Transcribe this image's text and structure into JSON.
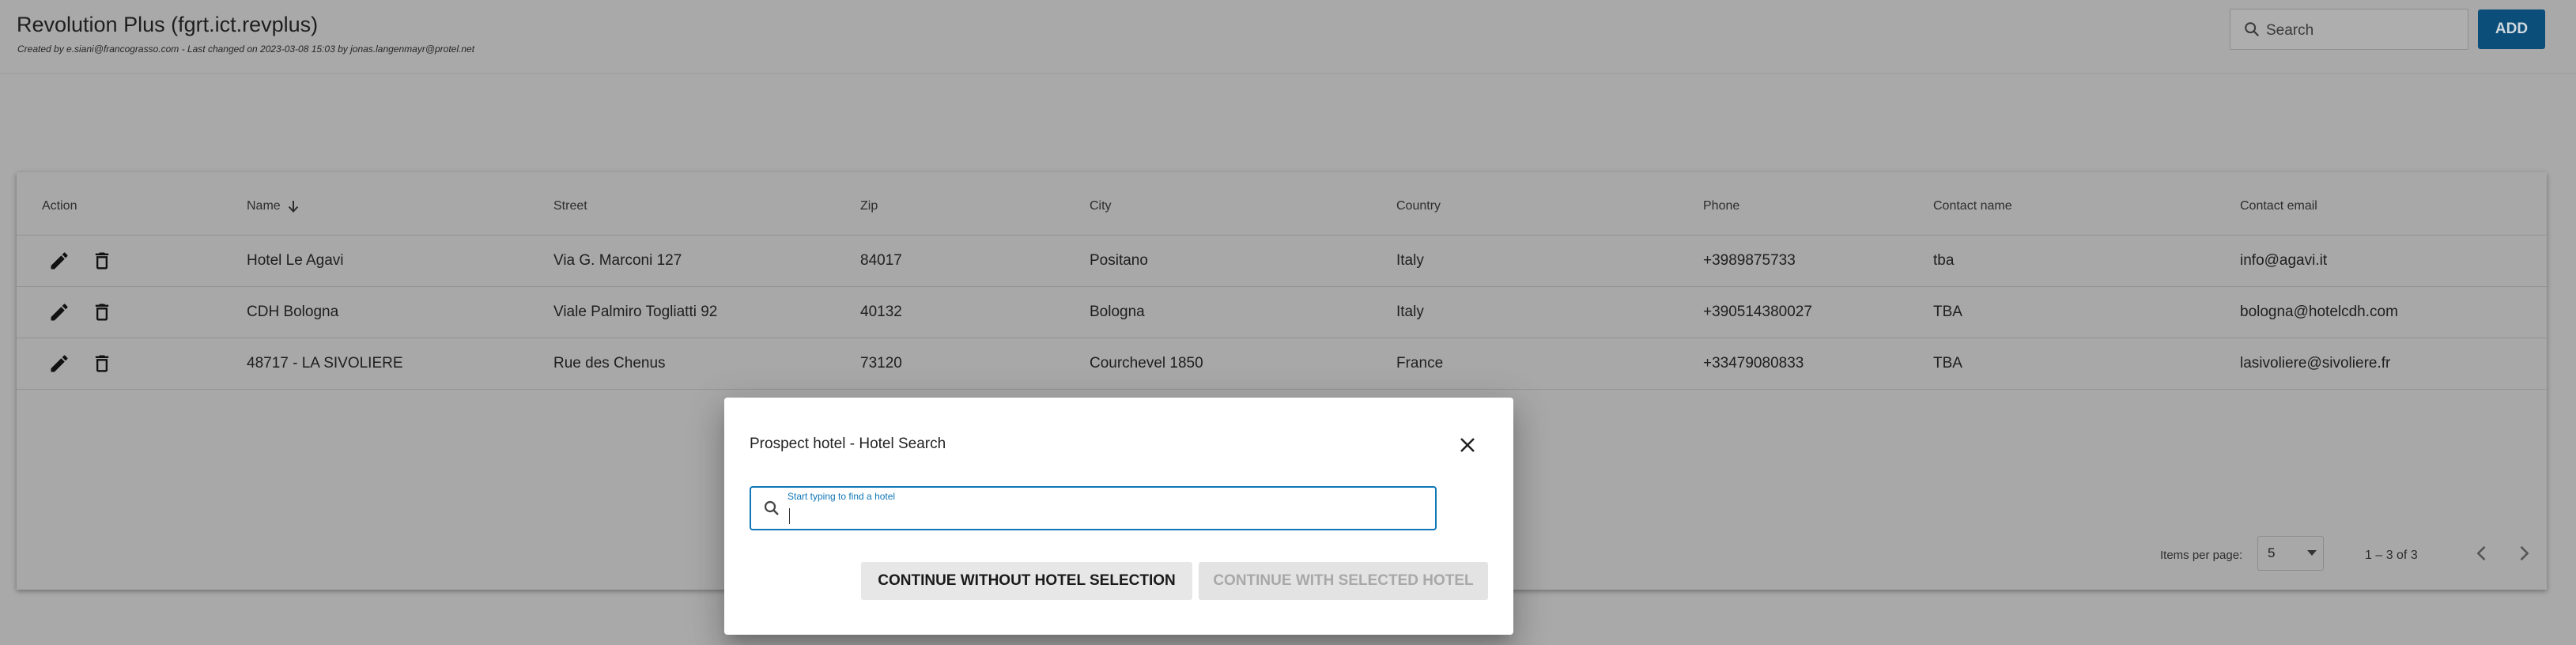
{
  "header": {
    "title": "Revolution Plus (fgrt.ict.revplus)",
    "subtitle": "Created by e.siani@francograsso.com - Last changed on 2023-03-08 15:03 by jonas.langenmayr@protel.net",
    "search_placeholder": "Search",
    "add_label": "ADD"
  },
  "table": {
    "columns": [
      "Action",
      "Name",
      "Street",
      "Zip",
      "City",
      "Country",
      "Phone",
      "Contact name",
      "Contact email"
    ],
    "rows": [
      {
        "name": "Hotel Le Agavi",
        "street": "Via G. Marconi 127",
        "zip": "84017",
        "city": "Positano",
        "country": "Italy",
        "phone": "+3989875733",
        "contact_name": "tba",
        "contact_email": "info@agavi.it"
      },
      {
        "name": "CDH Bologna",
        "street": "Viale Palmiro Togliatti 92",
        "zip": "40132",
        "city": "Bologna",
        "country": "Italy",
        "phone": "+390514380027",
        "contact_name": "TBA",
        "contact_email": "bologna@hotelcdh.com"
      },
      {
        "name": "48717 - LA SIVOLIERE",
        "street": "Rue des Chenus",
        "zip": "73120",
        "city": "Courchevel 1850",
        "country": "France",
        "phone": "+33479080833",
        "contact_name": "TBA",
        "contact_email": "lasivoliere@sivoliere.fr"
      }
    ]
  },
  "paginator": {
    "items_per_page_label": "Items per page:",
    "items_per_page_value": "5",
    "range_label": "1 – 3 of 3"
  },
  "dialog": {
    "title": "Prospect hotel - Hotel Search",
    "search_label": "Start typing to find a hotel",
    "search_value": "",
    "continue_without_label": "CONTINUE WITHOUT HOTEL SELECTION",
    "continue_with_label": "CONTINUE WITH SELECTED HOTEL"
  },
  "colors": {
    "accent": "#0f76b7",
    "add_button": "#0b4e7a",
    "overlay_bg": "#a9a9a9"
  }
}
